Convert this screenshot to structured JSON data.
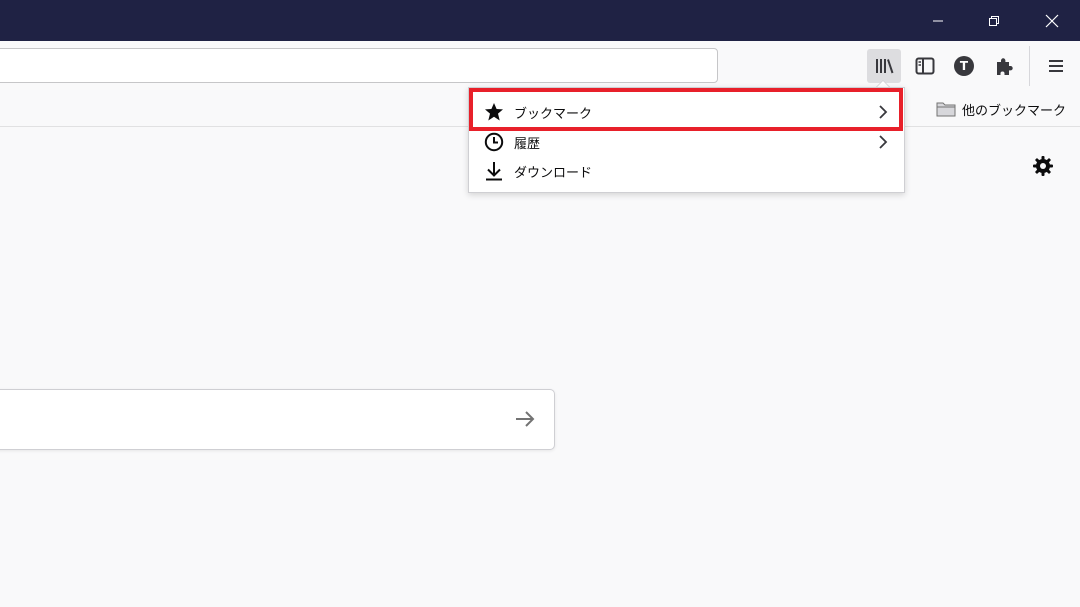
{
  "window_controls": {
    "minimize_icon": "minimize-icon",
    "restore_icon": "restore-icon",
    "close_icon": "close-icon"
  },
  "toolbar": {
    "url_value": "",
    "buttons": [
      "library-icon",
      "sidebar-icon",
      "account-t-icon",
      "extensions-icon",
      "hamburger-menu-icon"
    ],
    "account_letter": "T"
  },
  "bookmarks_bar": {
    "other_bookmarks_label": "他のブックマーク"
  },
  "library_panel": {
    "items": [
      {
        "label": "ブックマーク",
        "icon": "star-icon",
        "has_submenu": true
      },
      {
        "label": "履歴",
        "icon": "clock-icon",
        "has_submenu": true
      },
      {
        "label": "ダウンロード",
        "icon": "download-icon",
        "has_submenu": false
      }
    ],
    "highlight_color": "#e8202a"
  },
  "new_tab": {
    "search_value": "",
    "settings_icon": "gear-icon"
  },
  "colors": {
    "titlebar": "#1f2244",
    "page_background": "#f9f9fa",
    "highlight": "#e8202a"
  }
}
